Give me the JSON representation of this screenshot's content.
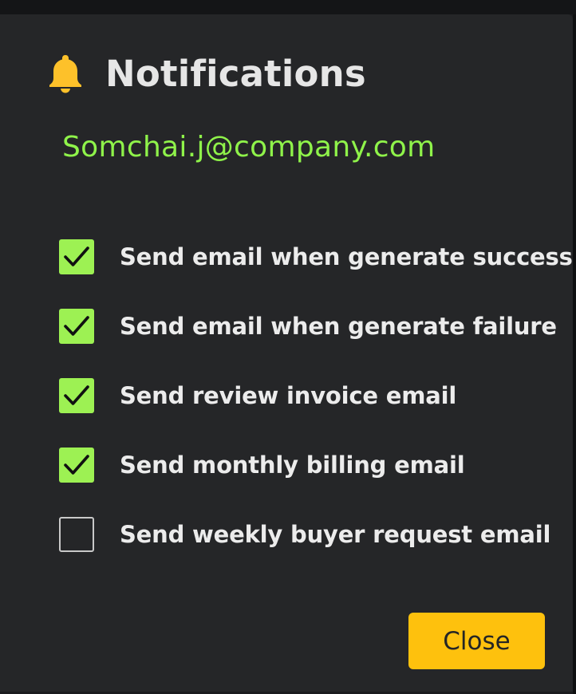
{
  "dialog": {
    "title": "Notifications",
    "title_icon": "bell-icon",
    "email": "Somchai.j@company.com"
  },
  "options": [
    {
      "label": "Send email when generate success",
      "checked": true
    },
    {
      "label": "Send email when generate failure",
      "checked": true
    },
    {
      "label": "Send review invoice email",
      "checked": true
    },
    {
      "label": "Send monthly billing email",
      "checked": true
    },
    {
      "label": "Send weekly buyer request email",
      "checked": false
    }
  ],
  "actions": {
    "close_label": "Close"
  },
  "colors": {
    "panel_background": "#252628",
    "accent_green": "#9df153",
    "email_text": "#8ff34a",
    "bell": "#fdc12a",
    "close_button": "#fec10d"
  }
}
